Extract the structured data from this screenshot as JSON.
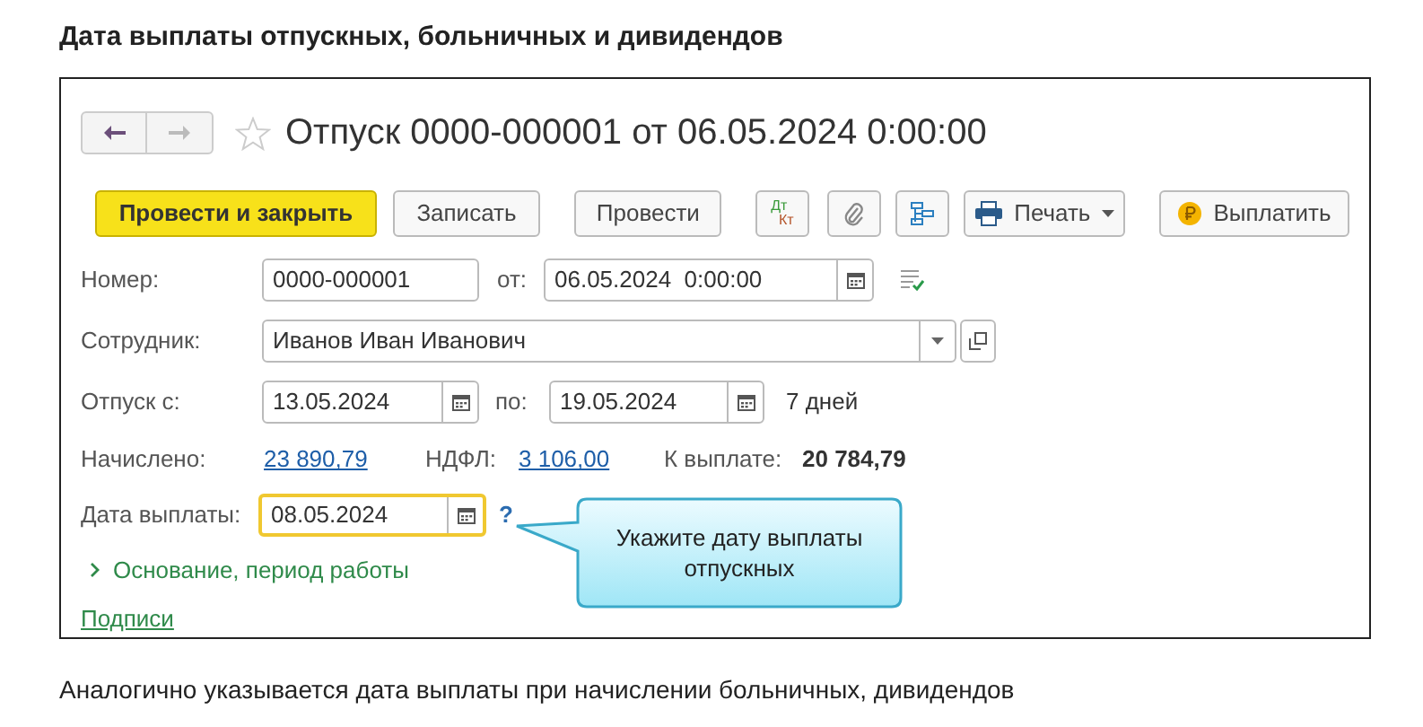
{
  "heading": "Дата выплаты отпускных, больничных и дивидендов",
  "document": {
    "title": "Отпуск 0000-000001 от 06.05.2024 0:00:00",
    "favorite": false,
    "toolbar": [
      {
        "kind": "primary",
        "label": "Провести и закрыть"
      },
      {
        "kind": "text",
        "label": "Записать"
      },
      {
        "kind": "text",
        "label": "Провести"
      },
      {
        "kind": "dtkt",
        "top": "Дт",
        "bottom": "Кт"
      },
      {
        "kind": "clip"
      },
      {
        "kind": "structure"
      },
      {
        "kind": "menu",
        "label": "Печать"
      },
      {
        "kind": "pay",
        "label": "Выплатить"
      }
    ],
    "number": {
      "label": "Номер:",
      "value": "0000-000001",
      "date_label": "от:",
      "date": "06.05.2024  0:00:00"
    },
    "employee": {
      "label": "Сотрудник:",
      "value": "Иванов Иван Иванович"
    },
    "period": {
      "label": "Отпуск с:",
      "from": "13.05.2024",
      "to_label": "по:",
      "to": "19.05.2024",
      "days": "7 дней"
    },
    "totals": {
      "accrued_label": "Начислено:",
      "accrued": "23 890,79",
      "tax_label": "НДФЛ:",
      "tax": "3 106,00",
      "payable_label": "К выплате:",
      "payable": "20 784,79"
    },
    "pay_date": {
      "label": "Дата выплаты:",
      "value": "08.05.2024",
      "highlighted": true,
      "help": "?"
    },
    "basis": {
      "label": "Основание, период работы",
      "expanded": false
    },
    "signatures": "Подписи"
  },
  "callout": "Укажите дату выплаты отпускных",
  "caption": "Аналогично указывается дата выплаты при начислении больничных, дивидендов"
}
